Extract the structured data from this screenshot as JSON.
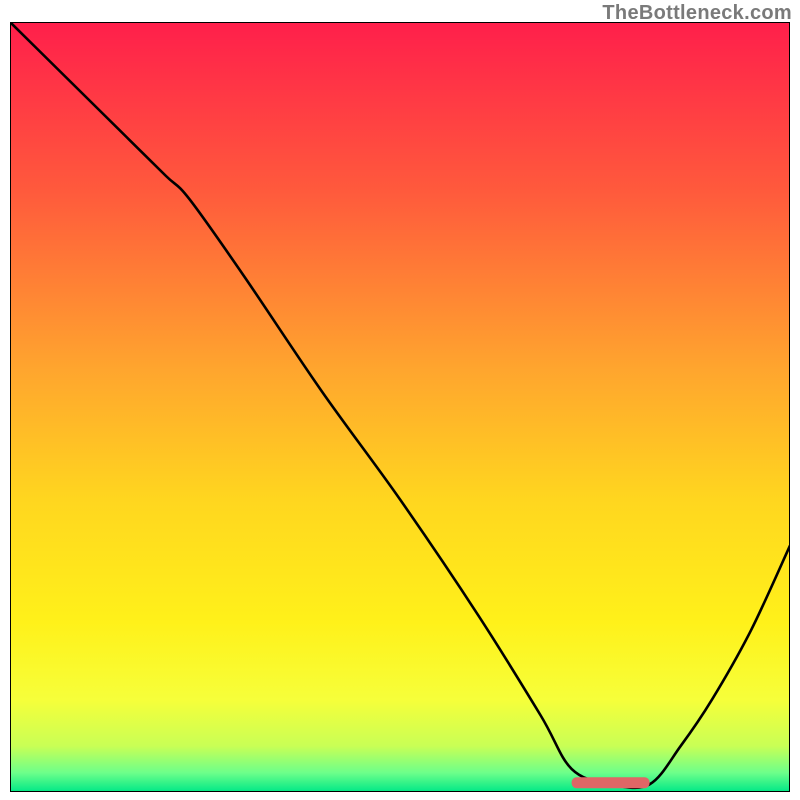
{
  "watermark": {
    "text": "TheBottleneck.com"
  },
  "colors": {
    "curve": "#000000",
    "marker": "#e06666",
    "frame": "#000000",
    "gradient_stops": [
      {
        "offset": 0.0,
        "color": "#ff1f4b"
      },
      {
        "offset": 0.22,
        "color": "#ff5a3c"
      },
      {
        "offset": 0.45,
        "color": "#ffa52e"
      },
      {
        "offset": 0.62,
        "color": "#ffd61f"
      },
      {
        "offset": 0.78,
        "color": "#fff11a"
      },
      {
        "offset": 0.88,
        "color": "#f6ff3a"
      },
      {
        "offset": 0.94,
        "color": "#c9ff55"
      },
      {
        "offset": 0.975,
        "color": "#6dff8a"
      },
      {
        "offset": 1.0,
        "color": "#00e887"
      }
    ]
  },
  "chart_data": {
    "type": "line",
    "title": "",
    "xlabel": "",
    "ylabel": "",
    "xlim": [
      0,
      100
    ],
    "ylim": [
      0,
      100
    ],
    "note": "Axes are not labeled in the image; values are estimated percentage positions. The curve drops from top-left, reaches a flat minimum near x≈72–82, then rises toward the right edge.",
    "series": [
      {
        "name": "bottleneck-curve",
        "x": [
          0,
          5,
          10,
          15,
          20,
          23,
          30,
          40,
          50,
          60,
          68,
          72,
          77,
          82,
          86,
          90,
          95,
          100
        ],
        "values": [
          100,
          95,
          90,
          85,
          80,
          77,
          67,
          52,
          38,
          23,
          10,
          3,
          1,
          1,
          6,
          12,
          21,
          32
        ]
      }
    ],
    "marker": {
      "name": "optimal-range",
      "x_start": 72,
      "x_end": 82,
      "y": 1.2,
      "color": "#e06666"
    }
  }
}
